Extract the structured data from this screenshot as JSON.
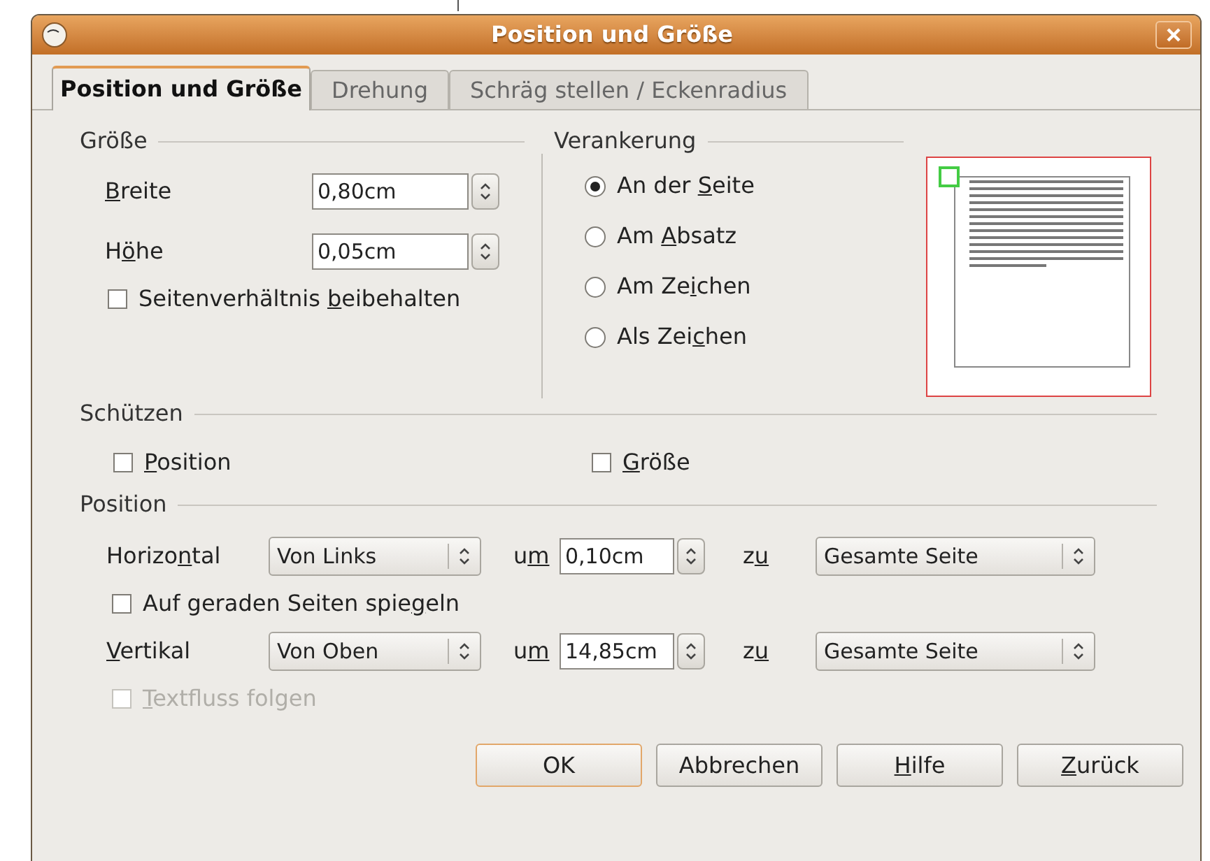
{
  "window": {
    "title": "Position und Größe"
  },
  "tabs": [
    {
      "label": "Position und Größe",
      "selected": true
    },
    {
      "label": "Drehung",
      "selected": false
    },
    {
      "label": "Schräg stellen / Eckenradius",
      "selected": false
    }
  ],
  "size": {
    "heading": "Größe",
    "fields": [
      {
        "label": {
          "key": "B",
          "post": "reite"
        },
        "value": "0,80cm"
      },
      {
        "label": {
          "pre": "H",
          "key": "ö",
          "post": "he"
        },
        "value": "0,05cm"
      }
    ],
    "keep_ratio": {
      "label": {
        "pre": "Seitenverhältnis ",
        "key": "b",
        "post": "eibehalten"
      },
      "checked": false,
      "disabled": false
    }
  },
  "anchor": {
    "heading": "Verankerung",
    "options": [
      {
        "label": {
          "pre": "An der ",
          "key": "S",
          "post": "eite"
        },
        "selected": true
      },
      {
        "label": {
          "pre": "Am ",
          "key": "A",
          "post": "bsatz"
        },
        "selected": false
      },
      {
        "label": {
          "pre": "Am Ze",
          "key": "i",
          "post": "chen"
        },
        "selected": false
      },
      {
        "label": {
          "pre": "Als Zei",
          "key": "c",
          "post": "hen"
        },
        "selected": false
      }
    ]
  },
  "protect": {
    "heading": "Schützen",
    "options": [
      {
        "label": {
          "key": "P",
          "post": "osition"
        },
        "checked": false,
        "disabled": false
      },
      {
        "label": {
          "key": "G",
          "post": "röße"
        },
        "checked": false,
        "disabled": false
      }
    ]
  },
  "position": {
    "heading": "Position",
    "rows": [
      {
        "label": {
          "pre": "Horizo",
          "key": "n",
          "post": "tal"
        },
        "select": "Von Links",
        "by": {
          "pre": "u",
          "key": "m"
        },
        "value": "0,10cm",
        "to": {
          "pre": "z",
          "key": "u"
        },
        "target": "Gesamte Seite",
        "option": {
          "label": {
            "pre": "Auf geraden Seiten spie",
            "key": "g",
            "post": "eln"
          },
          "checked": false,
          "disabled": false
        }
      },
      {
        "label": {
          "key": "V",
          "post": "ertikal"
        },
        "select": "Von Oben",
        "by": {
          "pre": "u",
          "key": "m"
        },
        "value": "14,85cm",
        "to": {
          "pre": "z",
          "key": "u"
        },
        "target": "Gesamte Seite",
        "option": {
          "label": {
            "key": "T",
            "post": "extfluss folgen"
          },
          "checked": false,
          "disabled": true
        }
      }
    ]
  },
  "buttons": [
    {
      "label": {
        "pre": "OK"
      },
      "default": true
    },
    {
      "label": {
        "pre": "Abbrechen"
      },
      "default": false
    },
    {
      "label": {
        "key": "H",
        "post": "ilfe"
      },
      "default": false
    },
    {
      "label": {
        "key": "Z",
        "post": "urück"
      },
      "default": false
    }
  ]
}
